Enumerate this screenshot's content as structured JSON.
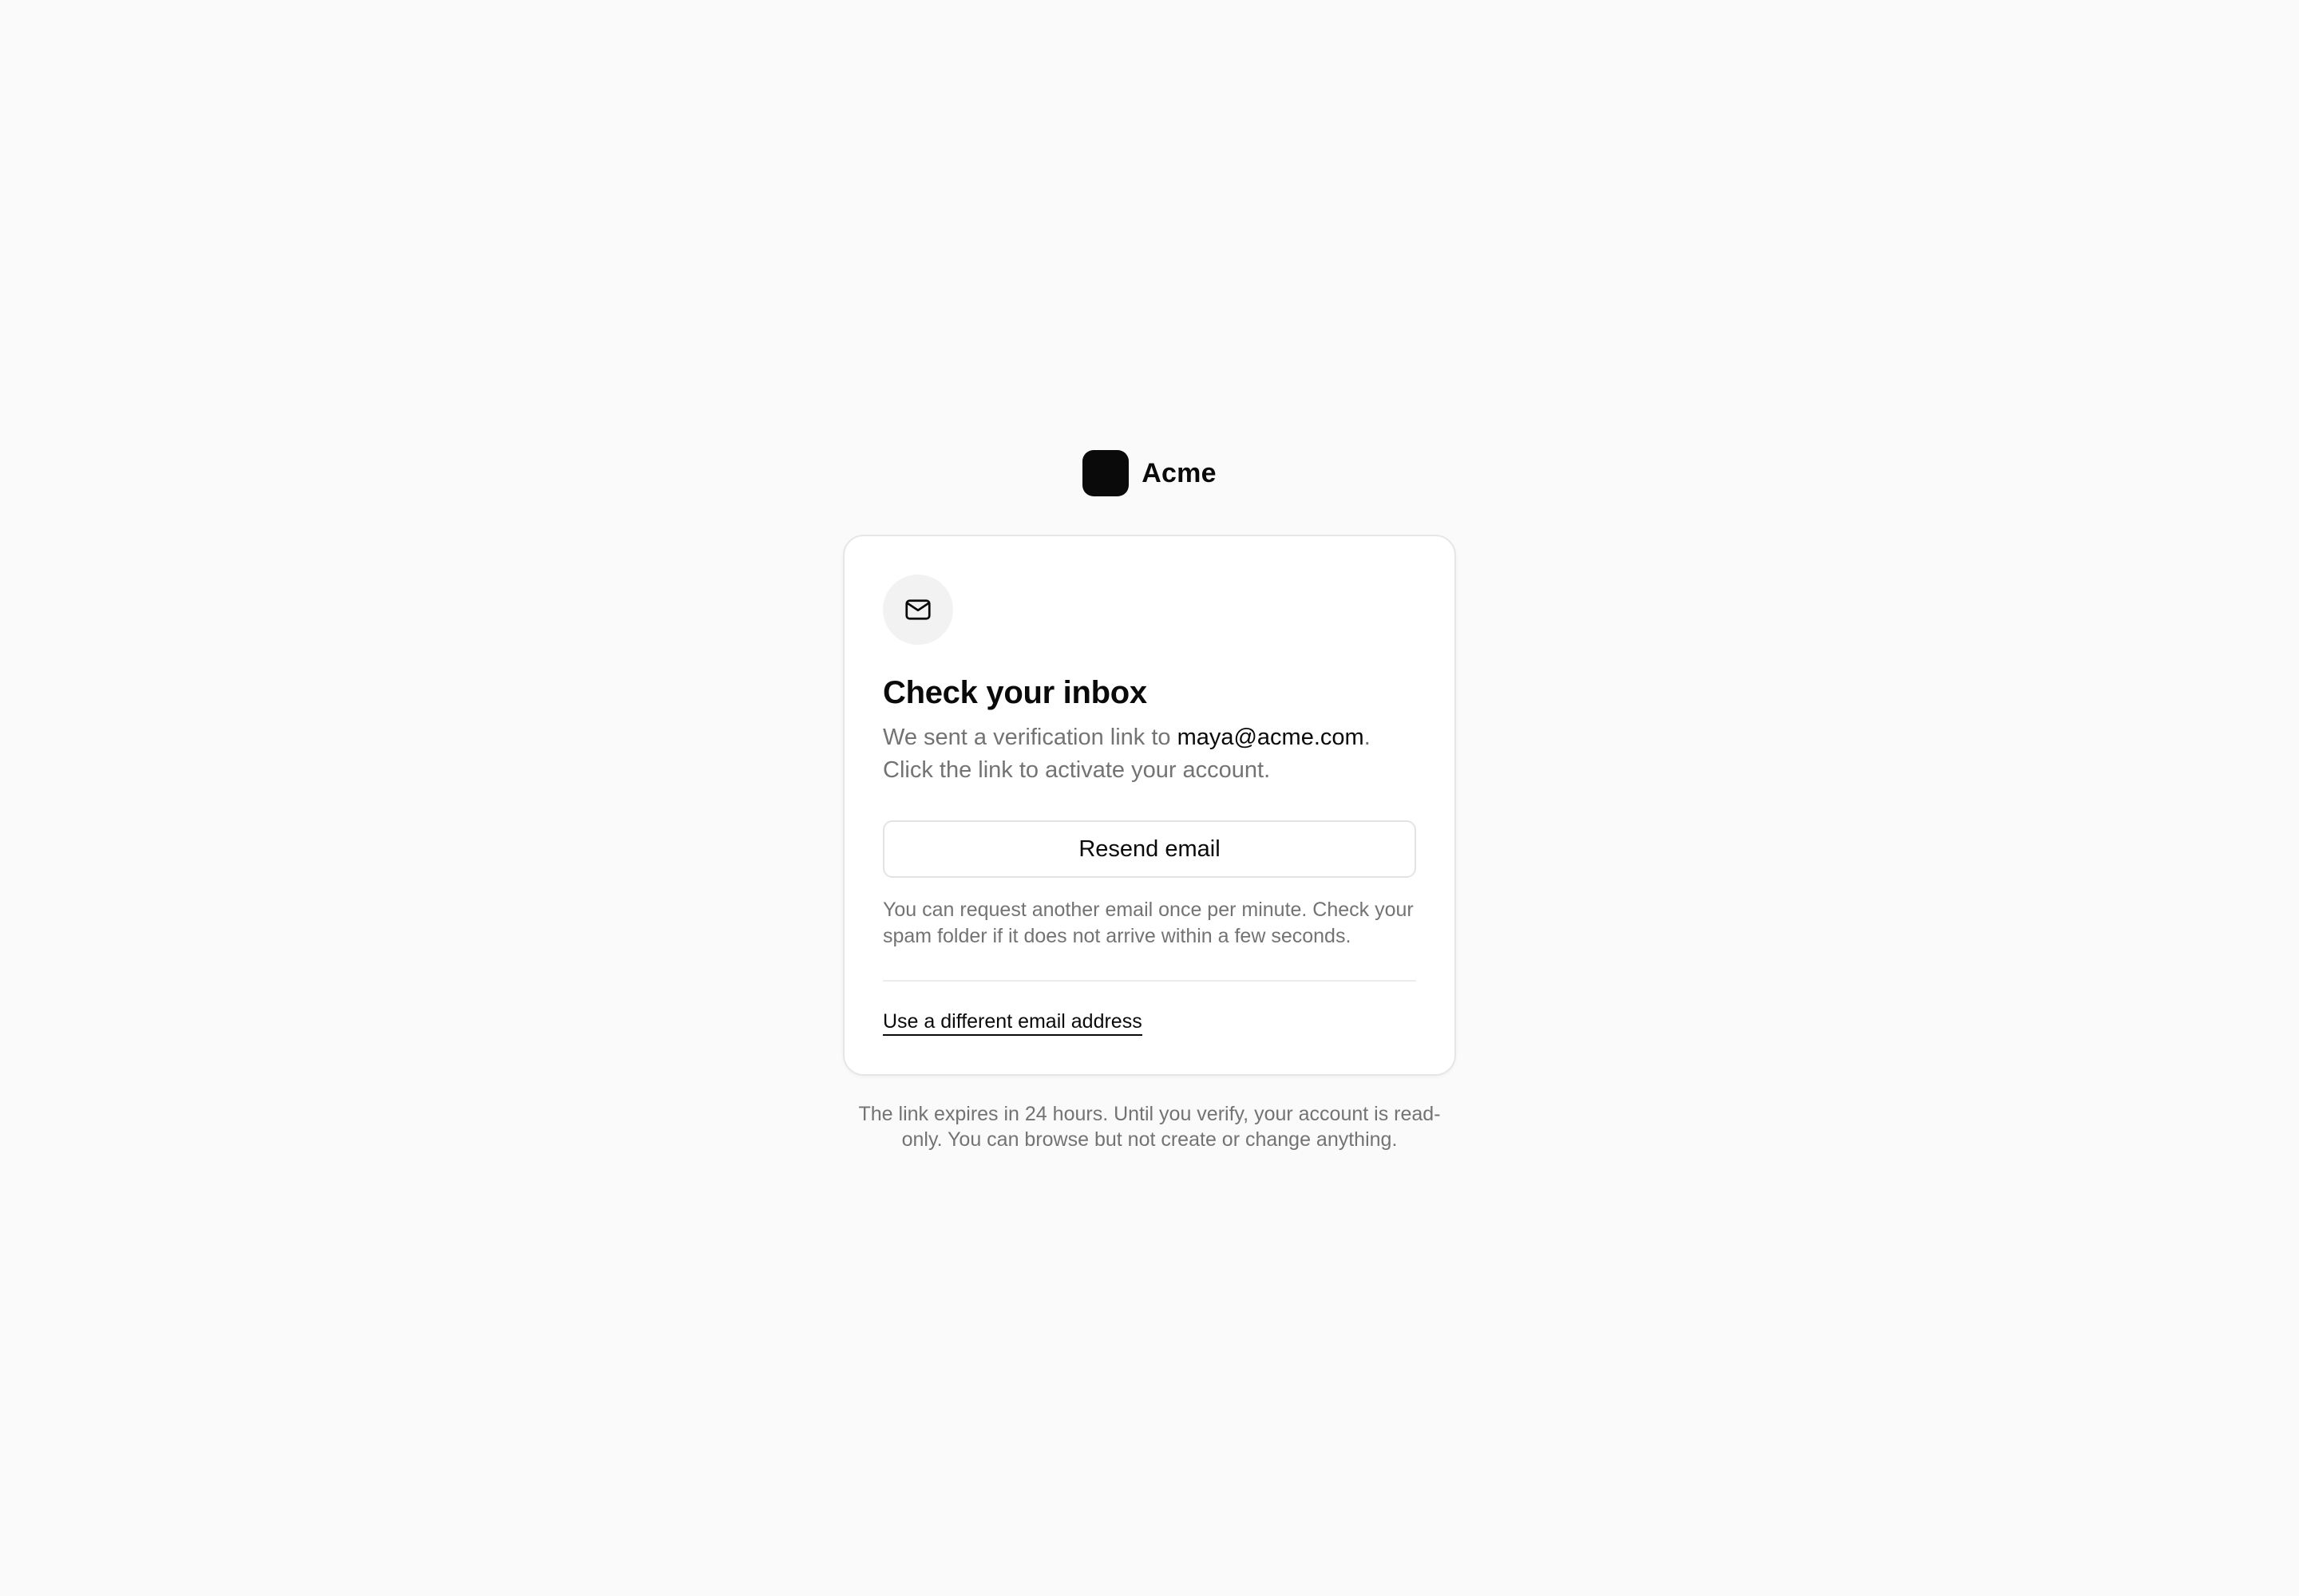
{
  "brand": {
    "name": "Acme",
    "icon": "acme-logo-mark"
  },
  "card": {
    "icon": "mail-icon",
    "title": "Check your inbox",
    "description_prefix": "We sent a verification link to ",
    "email": "maya@acme.com",
    "description_suffix": ".",
    "description_line2": "Click the link to activate your account.",
    "resend_label": "Resend email",
    "hint": "You can request another email once per minute. Check your spam folder if it does not arrive within a few seconds.",
    "alt_link": "Use a different email address"
  },
  "footnote": "The link expires in 24 hours. Until you verify, your account is read-only. You can browse but not create or change anything.",
  "colors": {
    "background": "#fafafa",
    "text": "#0a0a0a",
    "muted": "#737373",
    "card": "#ffffff",
    "border": "#e6e6e6"
  }
}
